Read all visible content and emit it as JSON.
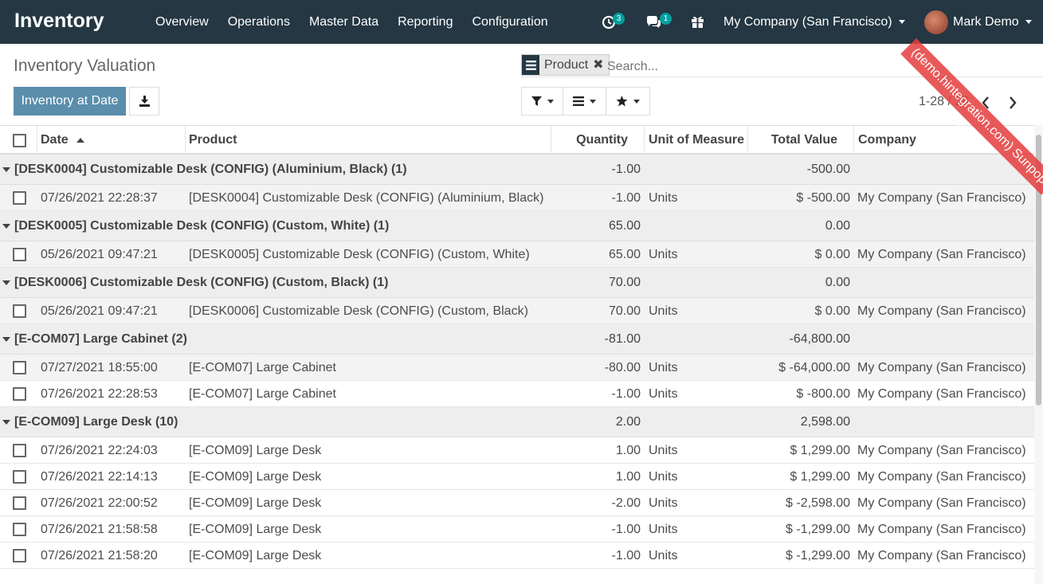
{
  "app": {
    "brand": "Inventory"
  },
  "menu": [
    "Overview",
    "Operations",
    "Master Data",
    "Reporting",
    "Configuration"
  ],
  "systray": {
    "activity_count": "3",
    "message_count": "1",
    "company": "My Company (San Francisco)",
    "user": "Mark Demo"
  },
  "ribbon": "(demo.hintegration.com) Sunpop Test",
  "page": {
    "title": "Inventory Valuation",
    "inventory_at_date": "Inventory at Date"
  },
  "search": {
    "facet": "Product",
    "placeholder": "Search..."
  },
  "pager": {
    "value": "1-28 / 28"
  },
  "columns": {
    "date": "Date",
    "product": "Product",
    "quantity": "Quantity",
    "uom": "Unit of Measure",
    "total_value": "Total Value",
    "company": "Company"
  },
  "rows": [
    {
      "type": "group",
      "label": "[DESK0004] Customizable Desk (CONFIG) (Aluminium, Black) (1)",
      "qty": "-1.00",
      "value": "-500.00"
    },
    {
      "type": "record",
      "date": "07/26/2021 22:28:37",
      "product": "[DESK0004] Customizable Desk (CONFIG) (Aluminium, Black)",
      "qty": "-1.00",
      "uom": "Units",
      "value": "$ -500.00",
      "company": "My Company (San Francisco)"
    },
    {
      "type": "group",
      "label": "[DESK0005] Customizable Desk (CONFIG) (Custom, White) (1)",
      "qty": "65.00",
      "value": "0.00"
    },
    {
      "type": "record",
      "date": "05/26/2021 09:47:21",
      "product": "[DESK0005] Customizable Desk (CONFIG) (Custom, White)",
      "qty": "65.00",
      "uom": "Units",
      "value": "$ 0.00",
      "company": "My Company (San Francisco)"
    },
    {
      "type": "group",
      "label": "[DESK0006] Customizable Desk (CONFIG) (Custom, Black) (1)",
      "qty": "70.00",
      "value": "0.00"
    },
    {
      "type": "record",
      "date": "05/26/2021 09:47:21",
      "product": "[DESK0006] Customizable Desk (CONFIG) (Custom, Black)",
      "qty": "70.00",
      "uom": "Units",
      "value": "$ 0.00",
      "company": "My Company (San Francisco)"
    },
    {
      "type": "group",
      "label": "[E-COM07] Large Cabinet (2)",
      "qty": "-81.00",
      "value": "-64,800.00"
    },
    {
      "type": "record",
      "date": "07/27/2021 18:55:00",
      "product": "[E-COM07] Large Cabinet",
      "qty": "-80.00",
      "uom": "Units",
      "value": "$ -64,000.00",
      "company": "My Company (San Francisco)"
    },
    {
      "type": "record",
      "date": "07/26/2021 22:28:53",
      "product": "[E-COM07] Large Cabinet",
      "qty": "-1.00",
      "uom": "Units",
      "value": "$ -800.00",
      "company": "My Company (San Francisco)"
    },
    {
      "type": "group",
      "label": "[E-COM09] Large Desk (10)",
      "qty": "2.00",
      "value": "2,598.00"
    },
    {
      "type": "record",
      "date": "07/26/2021 22:24:03",
      "product": "[E-COM09] Large Desk",
      "qty": "1.00",
      "uom": "Units",
      "value": "$ 1,299.00",
      "company": "My Company (San Francisco)"
    },
    {
      "type": "record",
      "date": "07/26/2021 22:14:13",
      "product": "[E-COM09] Large Desk",
      "qty": "1.00",
      "uom": "Units",
      "value": "$ 1,299.00",
      "company": "My Company (San Francisco)"
    },
    {
      "type": "record",
      "date": "07/26/2021 22:00:52",
      "product": "[E-COM09] Large Desk",
      "qty": "-2.00",
      "uom": "Units",
      "value": "$ -2,598.00",
      "company": "My Company (San Francisco)"
    },
    {
      "type": "record",
      "date": "07/26/2021 21:58:58",
      "product": "[E-COM09] Large Desk",
      "qty": "-1.00",
      "uom": "Units",
      "value": "$ -1,299.00",
      "company": "My Company (San Francisco)"
    },
    {
      "type": "record",
      "date": "07/26/2021 21:58:20",
      "product": "[E-COM09] Large Desk",
      "qty": "-1.00",
      "uom": "Units",
      "value": "$ -1,299.00",
      "company": "My Company (San Francisco)"
    }
  ],
  "colors": {
    "navbar": "#243742",
    "primary": "#5a8eab",
    "badge": "#00a09d",
    "ribbon": "#e53e3e",
    "group_bg": "#eeeeee"
  }
}
